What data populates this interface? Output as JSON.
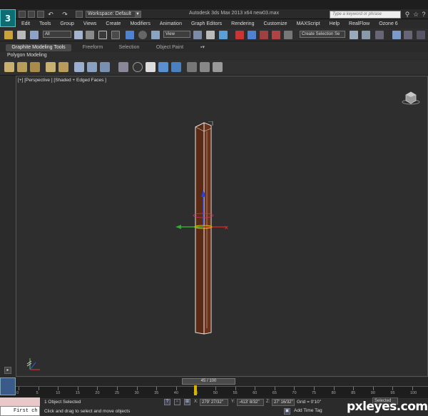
{
  "window": {
    "app_logo": "3",
    "workspace_label": "Workspace: Default",
    "title": "Autodesk 3ds Max  2013 x64      new03.max",
    "search_placeholder": "Type a keyword or phrase"
  },
  "menu": [
    "Edit",
    "Tools",
    "Group",
    "Views",
    "Create",
    "Modifiers",
    "Animation",
    "Graph Editors",
    "Rendering",
    "Customize",
    "MAXScript",
    "Help",
    "RealFlow",
    "Ozone 6"
  ],
  "toolbar": {
    "filter_value": "All",
    "ref_coord_value": "View",
    "selection_set_placeholder": "Create Selection Se"
  },
  "ribbon": {
    "tabs": [
      "Graphite Modeling Tools",
      "Freeform",
      "Selection",
      "Object Paint"
    ],
    "panel_label": "Polygon Modeling"
  },
  "viewport": {
    "label": "[+] [Perspective ] [Shaded + Edged Faces ]"
  },
  "timeline": {
    "slider_label": "45 / 100",
    "current_frame": 45,
    "total_frames": 100,
    "ticks": [
      "0",
      "5",
      "10",
      "15",
      "20",
      "25",
      "30",
      "35",
      "40",
      "45",
      "50",
      "55",
      "60",
      "65",
      "70",
      "75",
      "80",
      "85",
      "90",
      "95",
      "100"
    ]
  },
  "status": {
    "selection_info": "1 Object Selected",
    "prompt": "Click and drag to select and move objects",
    "maxscript_text": "First ch",
    "x_label": "X:",
    "x_value": "279' 27/32\"",
    "y_label": "Y:",
    "y_value": "-413' 8/32\"",
    "z_label": "Z:",
    "z_value": "27' 16/32\"",
    "grid": "Grid = 0'10\"",
    "add_time_tag": "Add Time Tag",
    "selected_dropdown": "Selected"
  },
  "watermark": "pxleyes.com",
  "colors": {
    "beam_wood": "#5a2a14",
    "beam_edge": "#e8e8e8",
    "viewport_bg": "#2e2e2e",
    "accent_blue": "#3b6fb5"
  }
}
